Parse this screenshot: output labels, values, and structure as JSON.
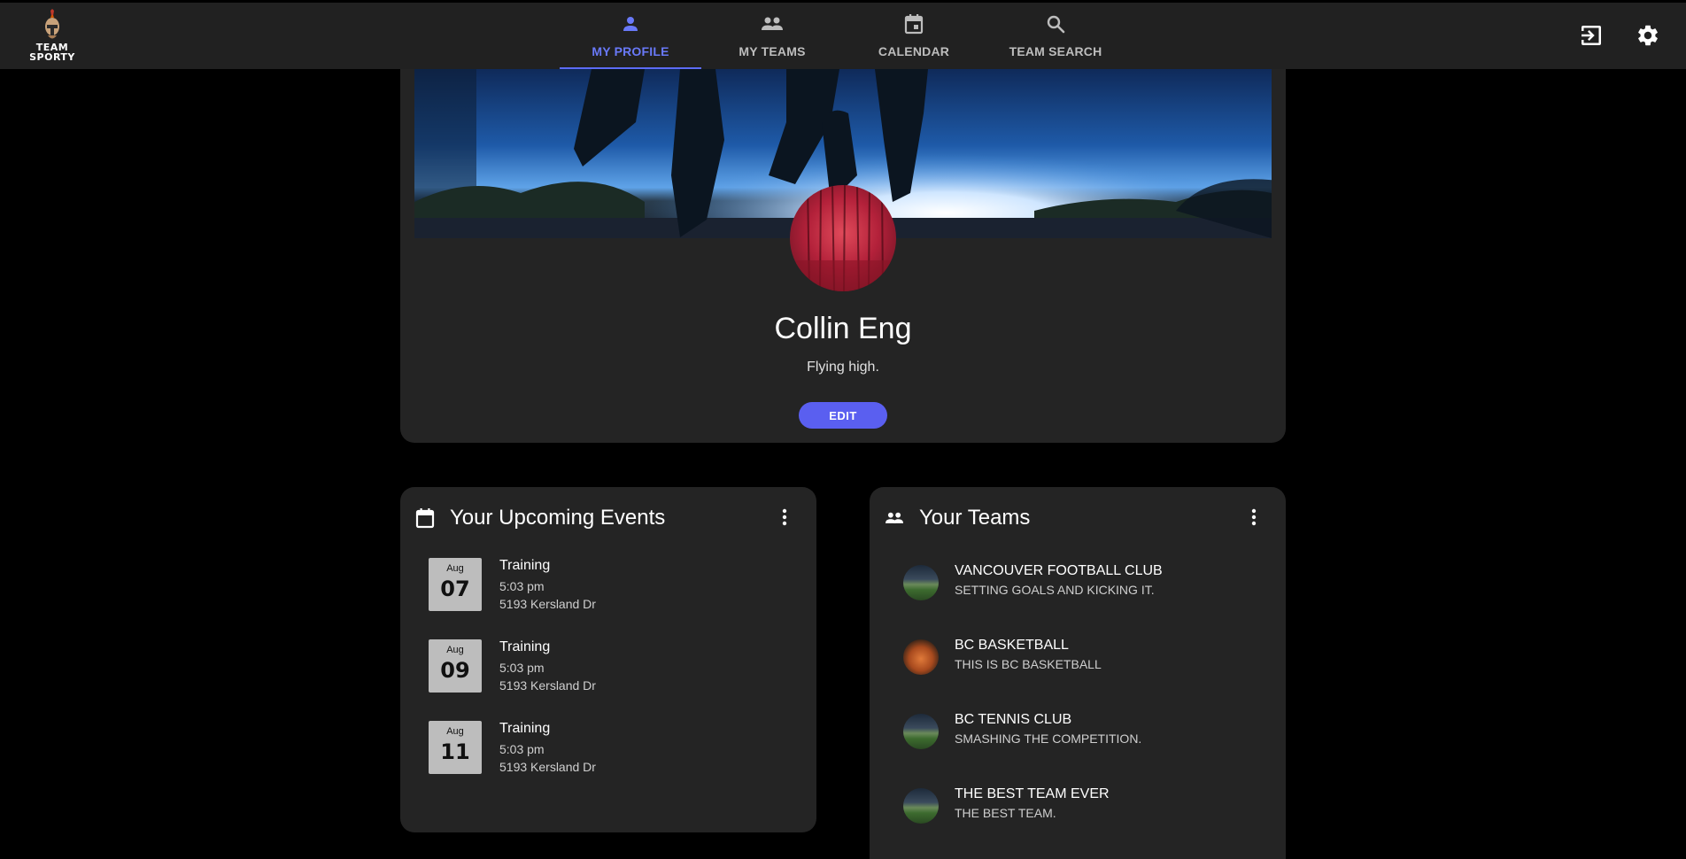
{
  "app": {
    "logo_line1": "TEAM",
    "logo_line2": "SPORTY"
  },
  "nav": {
    "items": [
      {
        "label": "MY PROFILE",
        "icon": "person-icon",
        "active": true
      },
      {
        "label": "MY TEAMS",
        "icon": "group-icon",
        "active": false
      },
      {
        "label": "CALENDAR",
        "icon": "calendar-icon",
        "active": false
      },
      {
        "label": "TEAM SEARCH",
        "icon": "search-icon",
        "active": false
      }
    ],
    "accent_color": "#5c6bf5"
  },
  "top_actions": {
    "logout_icon": "logout-icon",
    "settings_icon": "gear-icon"
  },
  "profile": {
    "name": "Collin Eng",
    "bio": "Flying high.",
    "edit_label": "EDIT"
  },
  "events": {
    "title": "Your Upcoming Events",
    "items": [
      {
        "month": "Aug",
        "day": "07",
        "title": "Training",
        "time": "5:03 pm",
        "location": "5193 Kersland Dr"
      },
      {
        "month": "Aug",
        "day": "09",
        "title": "Training",
        "time": "5:03 pm",
        "location": "5193 Kersland Dr"
      },
      {
        "month": "Aug",
        "day": "11",
        "title": "Training",
        "time": "5:03 pm",
        "location": "5193 Kersland Dr"
      }
    ]
  },
  "teams": {
    "title": "Your Teams",
    "items": [
      {
        "name": "VANCOUVER FOOTBALL CLUB",
        "description": "SETTING GOALS AND KICKING IT."
      },
      {
        "name": "BC BASKETBALL",
        "description": "THIS IS BC BASKETBALL"
      },
      {
        "name": "BC TENNIS CLUB",
        "description": "SMASHING THE COMPETITION."
      },
      {
        "name": "THE BEST TEAM EVER",
        "description": "THE BEST TEAM."
      }
    ]
  }
}
